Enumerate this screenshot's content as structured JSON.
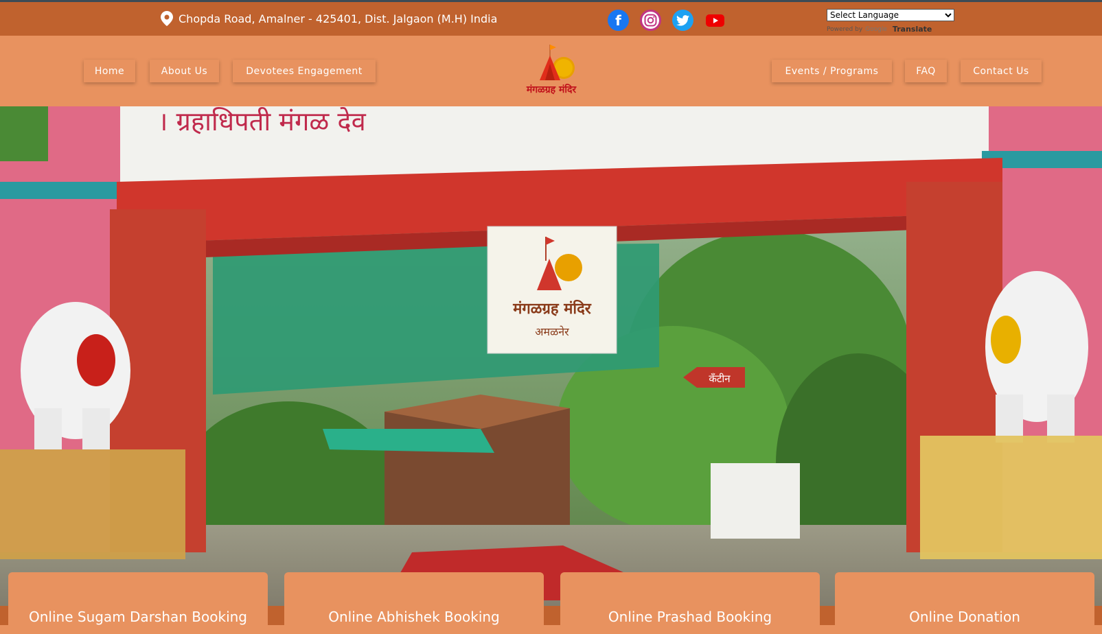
{
  "topbar": {
    "address": "Chopda Road, Amalner - 425401, Dist. Jalgaon (M.H) India",
    "social": [
      "facebook-icon",
      "instagram-icon",
      "twitter-icon",
      "youtube-icon"
    ],
    "language_select": "Select Language",
    "powered_by": "Powered by",
    "google": "Google",
    "translate": "Translate"
  },
  "nav": {
    "left": [
      "Home",
      "About Us",
      "Devotees Engagement"
    ],
    "right": [
      "Events / Programs",
      "FAQ",
      "Contact Us"
    ],
    "logo_text": "मंगळग्रह मंदिर"
  },
  "hero": {
    "sign_title": "मंगळग्रह मंदिर",
    "sign_subtitle": "अमळनेर",
    "canteen_sign": "कॅंटीन"
  },
  "cards": [
    "Online Sugam Darshan Booking",
    "Online Abhishek Booking",
    "Online Prashad Booking",
    "Online Donation"
  ],
  "colors": {
    "topbar": "#c0622e",
    "nav": "#e8925f",
    "accent": "#ff8c00"
  }
}
